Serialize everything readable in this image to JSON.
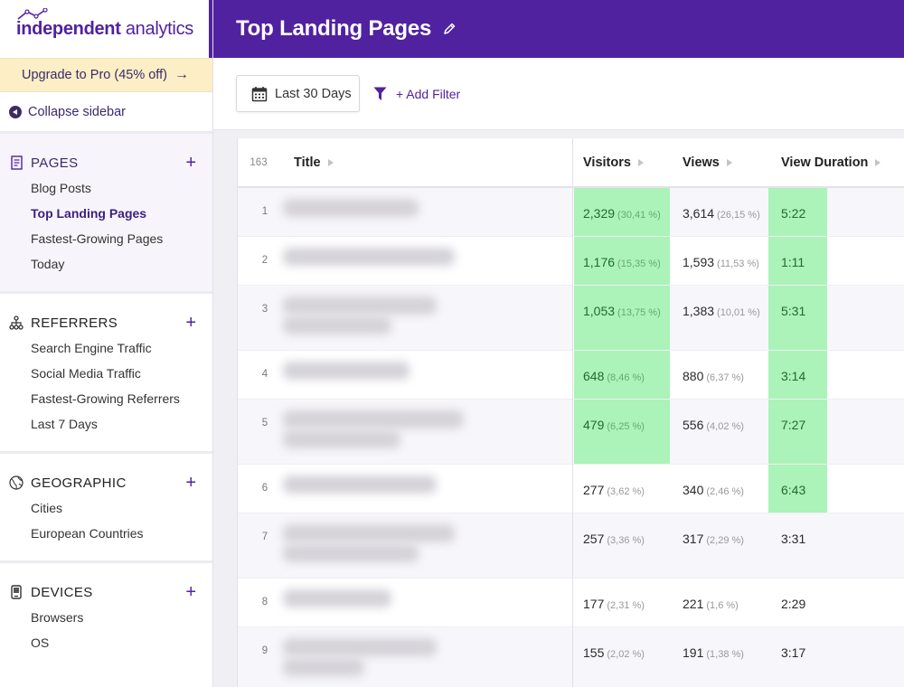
{
  "brand": {
    "logo_bold": "independent",
    "logo_light": " analytics",
    "accent": "#5022a0"
  },
  "sidebar": {
    "upgrade_label": "Upgrade to Pro (45% off)",
    "upgrade_arrow": "→",
    "collapse_label": "Collapse sidebar",
    "sections": [
      {
        "title": "PAGES",
        "icon": "document-icon",
        "items": [
          "Blog Posts",
          "Top Landing Pages",
          "Fastest-Growing Pages",
          "Today"
        ],
        "current": "Top Landing Pages"
      },
      {
        "title": "REFERRERS",
        "icon": "network-icon",
        "items": [
          "Search Engine Traffic",
          "Social Media Traffic",
          "Fastest-Growing Referrers",
          "Last 7 Days"
        ]
      },
      {
        "title": "GEOGRAPHIC",
        "icon": "globe-icon",
        "items": [
          "Cities",
          "European Countries"
        ]
      },
      {
        "title": "DEVICES",
        "icon": "phone-icon",
        "items": [
          "Browsers",
          "OS"
        ]
      }
    ],
    "plus": "+"
  },
  "header": {
    "title": "Top Landing Pages"
  },
  "toolbar": {
    "date_range": "Last 30 Days",
    "add_filter": "+ Add Filter"
  },
  "table": {
    "count": "163",
    "columns": {
      "title": "Title",
      "visitors": "Visitors",
      "views": "Views",
      "duration": "View Duration"
    },
    "rows": [
      {
        "rank": "1",
        "visitors": "2,329",
        "visitors_pct": "(30,41 %)",
        "views": "3,614",
        "views_pct": "(26,15 %)",
        "duration": "5:22",
        "hl_visitors": true,
        "hl_duration": true
      },
      {
        "rank": "2",
        "visitors": "1,176",
        "visitors_pct": "(15,35 %)",
        "views": "1,593",
        "views_pct": "(11,53 %)",
        "duration": "1:11",
        "hl_visitors": true,
        "hl_duration": true
      },
      {
        "rank": "3",
        "visitors": "1,053",
        "visitors_pct": "(13,75 %)",
        "views": "1,383",
        "views_pct": "(10,01 %)",
        "duration": "5:31",
        "hl_visitors": true,
        "hl_duration": true
      },
      {
        "rank": "4",
        "visitors": "648",
        "visitors_pct": "(8,46 %)",
        "views": "880",
        "views_pct": "(6,37 %)",
        "duration": "3:14",
        "hl_visitors": true,
        "hl_duration": true
      },
      {
        "rank": "5",
        "visitors": "479",
        "visitors_pct": "(6,25 %)",
        "views": "556",
        "views_pct": "(4,02 %)",
        "duration": "7:27",
        "hl_visitors": true,
        "hl_duration": true
      },
      {
        "rank": "6",
        "visitors": "277",
        "visitors_pct": "(3,62 %)",
        "views": "340",
        "views_pct": "(2,46 %)",
        "duration": "6:43",
        "hl_visitors": false,
        "hl_duration": true
      },
      {
        "rank": "7",
        "visitors": "257",
        "visitors_pct": "(3,36 %)",
        "views": "317",
        "views_pct": "(2,29 %)",
        "duration": "3:31",
        "hl_visitors": false,
        "hl_duration": false
      },
      {
        "rank": "8",
        "visitors": "177",
        "visitors_pct": "(2,31 %)",
        "views": "221",
        "views_pct": "(1,6 %)",
        "duration": "2:29",
        "hl_visitors": false,
        "hl_duration": false
      },
      {
        "rank": "9",
        "visitors": "155",
        "visitors_pct": "(2,02 %)",
        "views": "191",
        "views_pct": "(1,38 %)",
        "duration": "3:17",
        "hl_visitors": false,
        "hl_duration": false
      }
    ]
  }
}
